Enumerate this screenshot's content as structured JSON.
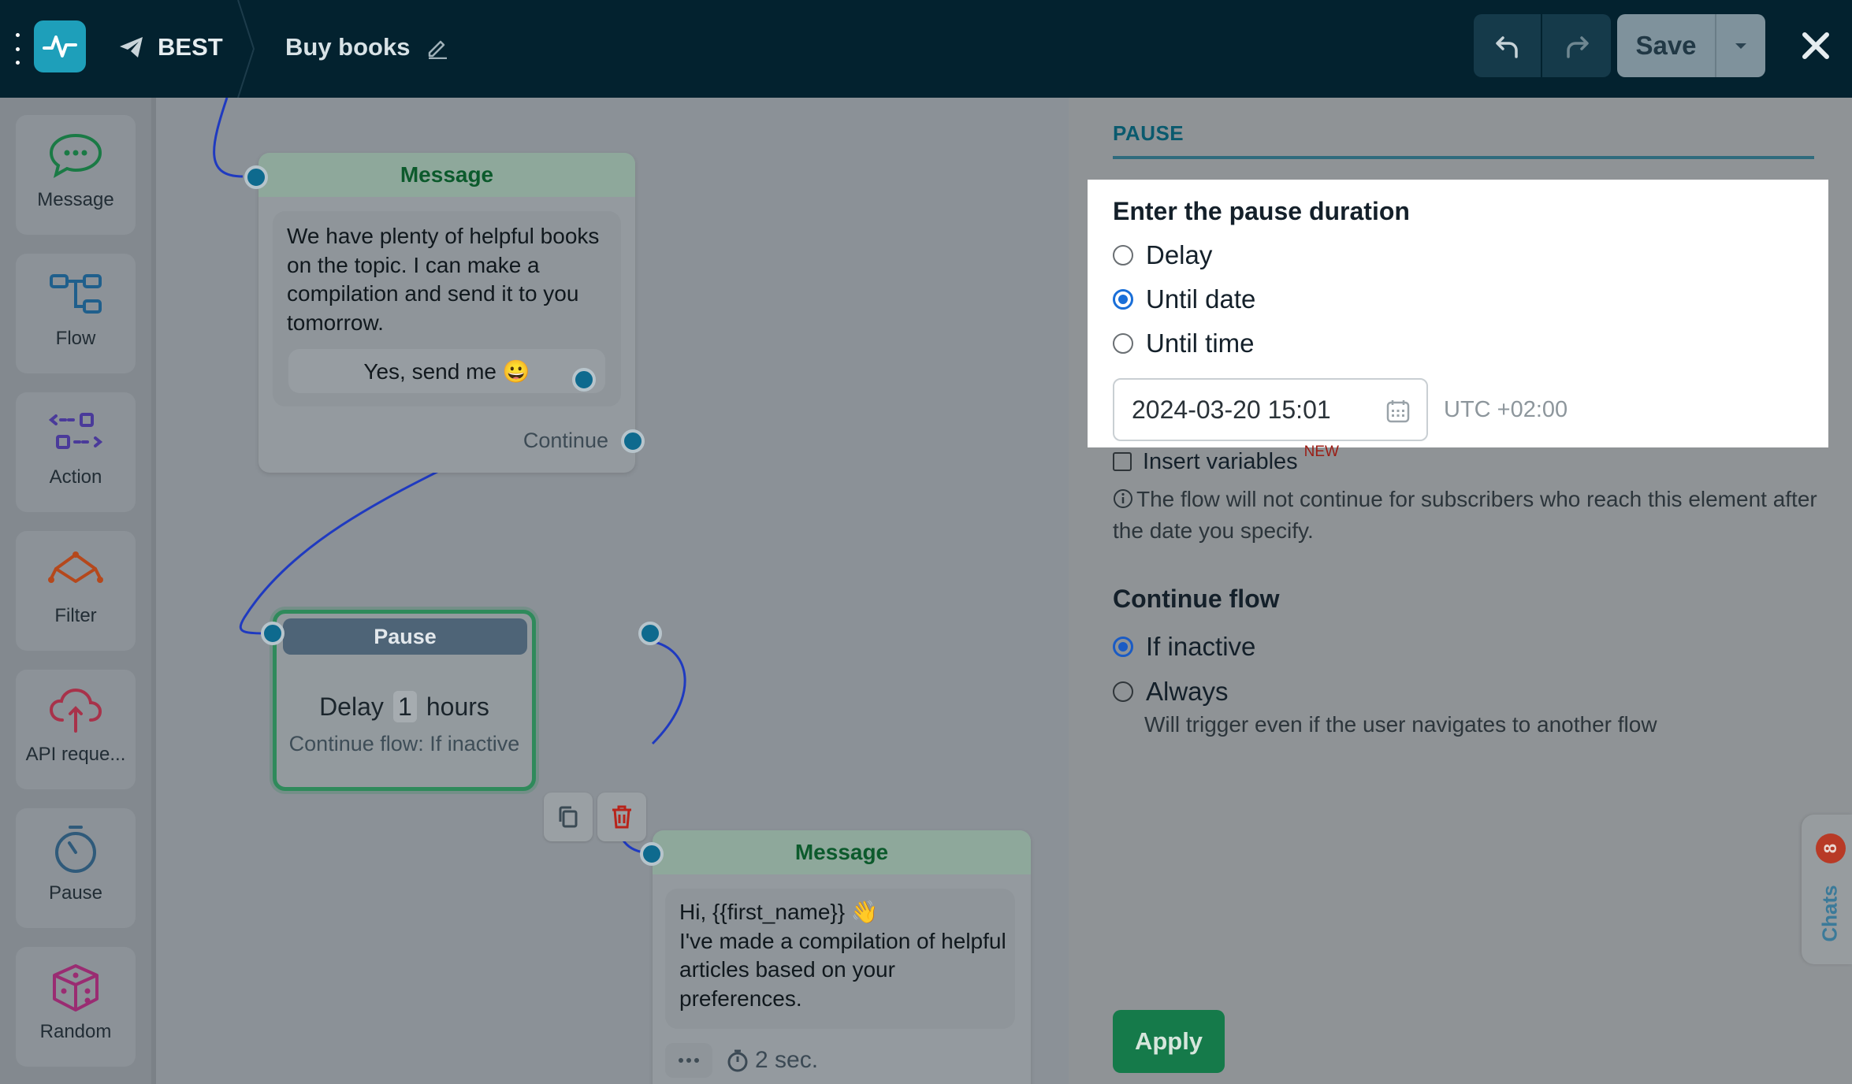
{
  "topbar": {
    "channel_name": "BEST",
    "flow_title": "Buy books",
    "save_label": "Save"
  },
  "sidebar": {
    "items": [
      {
        "label": "Message",
        "icon": "chat-bubble-icon"
      },
      {
        "label": "Flow",
        "icon": "flow-icon"
      },
      {
        "label": "Action",
        "icon": "action-icon"
      },
      {
        "label": "Filter",
        "icon": "filter-icon"
      },
      {
        "label": "API reque...",
        "icon": "cloud-api-icon"
      },
      {
        "label": "Pause",
        "icon": "stopwatch-icon"
      },
      {
        "label": "Random",
        "icon": "dice-icon"
      }
    ]
  },
  "canvas": {
    "message1": {
      "title": "Message",
      "text": "We have plenty of helpful books on the topic. I can make a compilation and send it to you tomorrow.",
      "button": "Yes, send me 😀",
      "continue_label": "Continue"
    },
    "pause_node": {
      "title": "Pause",
      "prefix": "Delay",
      "value": "1",
      "unit": "hours",
      "subtitle": "Continue flow: If inactive"
    },
    "message2": {
      "title": "Message",
      "text_line1": "Hi,  {{first_name}} 👋",
      "text_rest": "I've made a compilation of helpful articles based on your preferences.",
      "delay": "2 sec."
    }
  },
  "panel": {
    "section_title": "PAUSE",
    "duration_title": "Enter the pause duration",
    "options": [
      "Delay",
      "Until date",
      "Until time"
    ],
    "selected_option": "Until date",
    "date_value": "2024-03-20 15:01",
    "timezone": "UTC +02:00",
    "insert_variables_label": "Insert variables",
    "new_badge": "NEW",
    "hint": "The flow will not continue for subscribers who reach this element after the date you specify.",
    "continue_title": "Continue flow",
    "continue_options": [
      "If inactive",
      "Always"
    ],
    "continue_selected": "If inactive",
    "always_hint": "Will trigger even if the user navigates to another flow",
    "apply_label": "Apply"
  },
  "chats": {
    "label": "Chats",
    "count": "8"
  },
  "colors": {
    "topbar_bg": "#03222f",
    "logo_bg": "#1e9fba",
    "accent_blue": "#1a6fd8",
    "apply_green": "#157a4a",
    "message_title_green": "#0c5a2c",
    "delete_red": "#b8231a"
  }
}
